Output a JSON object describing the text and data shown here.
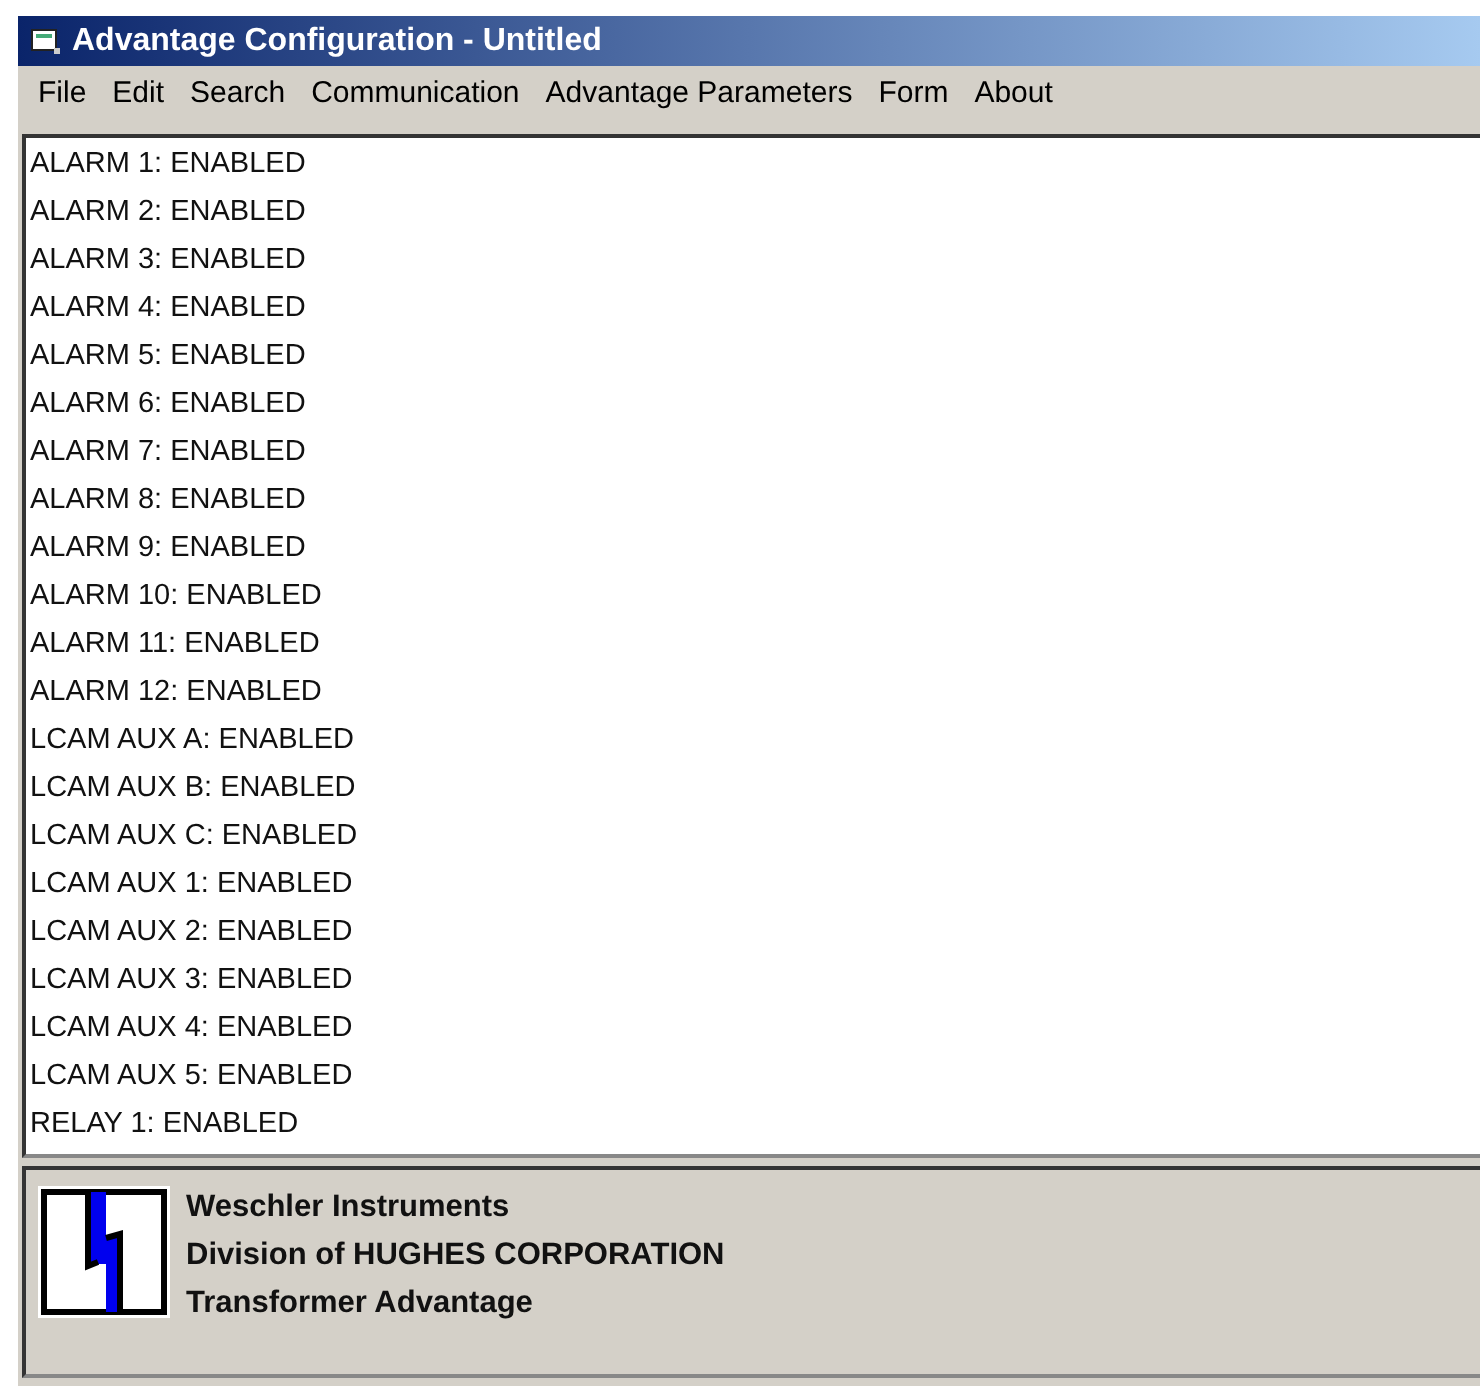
{
  "window": {
    "title": "Advantage Configuration - Untitled"
  },
  "menu": [
    "File",
    "Edit",
    "Search",
    "Communication",
    "Advantage Parameters",
    "Form",
    "About"
  ],
  "list": [
    "ALARM 1: ENABLED",
    "ALARM 2: ENABLED",
    "ALARM 3: ENABLED",
    "ALARM 4: ENABLED",
    "ALARM 5: ENABLED",
    "ALARM 6: ENABLED",
    "ALARM 7: ENABLED",
    "ALARM 8: ENABLED",
    "ALARM 9: ENABLED",
    "ALARM 10: ENABLED",
    "ALARM 11: ENABLED",
    "ALARM 12: ENABLED",
    "LCAM AUX A: ENABLED",
    "LCAM AUX B: ENABLED",
    "LCAM AUX C: ENABLED",
    "LCAM AUX 1: ENABLED",
    "LCAM AUX 2: ENABLED",
    "LCAM AUX 3: ENABLED",
    "LCAM AUX 4: ENABLED",
    "LCAM AUX 5: ENABLED",
    "RELAY 1: ENABLED"
  ],
  "footer": [
    "Weschler Instruments",
    "Division of HUGHES CORPORATION",
    "Transformer Advantage"
  ]
}
